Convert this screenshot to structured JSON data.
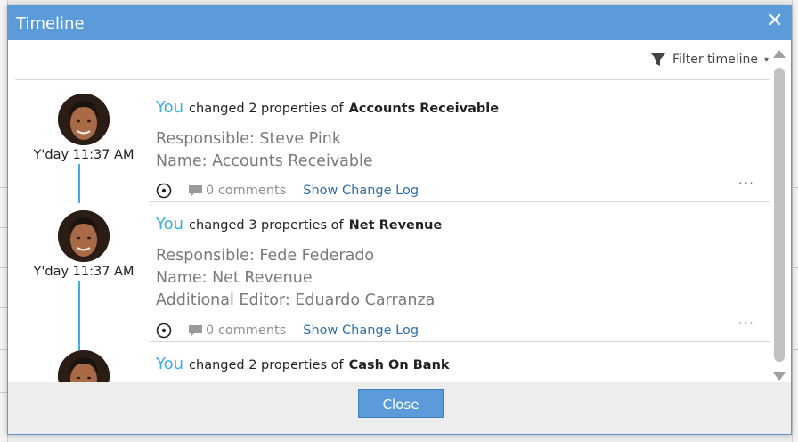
{
  "dialog": {
    "title": "Timeline",
    "close_glyph": "✕"
  },
  "toolbar": {
    "filter_label": "Filter timeline",
    "filter_caret": "▾",
    "filter_icon": "funnel-icon"
  },
  "entries": [
    {
      "who": "You",
      "action": "changed 2 properties of",
      "object": "Accounts Receivable",
      "time": "Y'day 11:37 AM",
      "properties": [
        "Responsible: Steve Pink",
        "Name: Accounts Receivable"
      ],
      "comments": "0 comments",
      "change_log": "Show Change Log",
      "more": "···"
    },
    {
      "who": "You",
      "action": "changed 3 properties of",
      "object": "Net Revenue",
      "time": "Y'day 11:37 AM",
      "properties": [
        "Responsible: Fede Federado",
        "Name: Net Revenue",
        "Additional Editor: Eduardo Carranza"
      ],
      "comments": "0 comments",
      "change_log": "Show Change Log",
      "more": "···"
    },
    {
      "who": "You",
      "action": "changed 2 properties of",
      "object": "Cash On Bank"
    }
  ],
  "footer": {
    "close_label": "Close"
  },
  "colors": {
    "header": "#5b9bd9",
    "who": "#3ab0dd",
    "link": "#2e6fa7",
    "connector": "#39b1db"
  }
}
